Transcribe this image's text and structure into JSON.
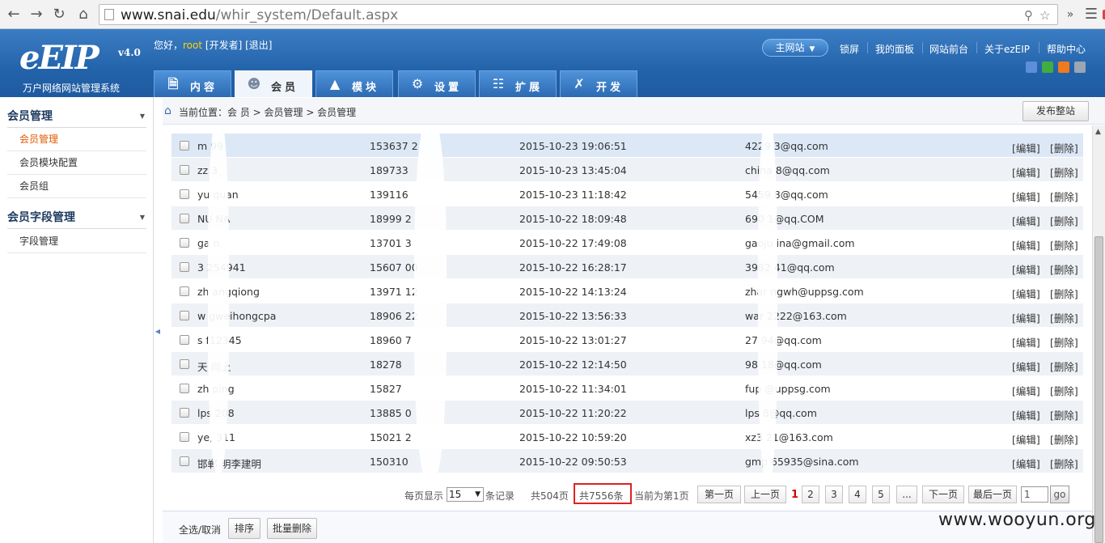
{
  "browser": {
    "url_host": "www.snai.edu",
    "url_path": "/whir_system/Default.aspx",
    "ext_badge": "6"
  },
  "header": {
    "logo": "eEIP",
    "logo_version": "v4.0",
    "logo_sub": "万户网络网站管理系统",
    "greeting": "您好，",
    "user": "root",
    "greeting_rest": "[开发者] [退出]",
    "site_select": "主网站",
    "links": [
      "锁屏",
      "我的面板",
      "网站前台",
      "关于ezEIP",
      "帮助中心"
    ],
    "skin_colors": [
      "#5b8fd6",
      "#3fae3f",
      "#f07a1e",
      "#9aa6b2"
    ],
    "tabs": [
      {
        "label": "内容",
        "icon": "document-icon"
      },
      {
        "label": "会员",
        "icon": "users-icon"
      },
      {
        "label": "模块",
        "icon": "cars-icon"
      },
      {
        "label": "设置",
        "icon": "gear-icon"
      },
      {
        "label": "扩展",
        "icon": "sitemap-icon"
      },
      {
        "label": "开发",
        "icon": "tools-icon"
      }
    ]
  },
  "sidebar": {
    "group1": "会员管理",
    "group1_items": [
      "会员管理",
      "会员模块配置",
      "会员组"
    ],
    "group2": "会员字段管理",
    "group2_items": [
      "字段管理"
    ]
  },
  "crumb": {
    "text": "当前位置：会 员 > 会员管理 > 会员管理",
    "publish": "发布整站"
  },
  "table": {
    "edit": "[编辑]",
    "delete": "[删除]",
    "rows": [
      {
        "name": "m    99",
        "phone": "153637    2",
        "time": "2015-10-23 19:06:51",
        "email": "4229      3@qq.com"
      },
      {
        "name": "zz    3",
        "phone": "189733",
        "time": "2015-10-23 13:45:04",
        "email": "china      8@qq.com"
      },
      {
        "name": "yu    quan",
        "phone": "139116",
        "time": "2015-10-23 11:18:42",
        "email": "5459      8@qq.com"
      },
      {
        "name": "NU    NA",
        "phone": "18999      2",
        "time": "2015-10-22 18:09:48",
        "email": "690      1@qq.COM"
      },
      {
        "name": "ga    n",
        "phone": "13701      3",
        "time": "2015-10-22 17:49:08",
        "email": "gaoju    ina@gmail.com"
      },
      {
        "name": "3    254941",
        "phone": "15607      00",
        "time": "2015-10-22 16:28:17",
        "email": "3982    41@qq.com"
      },
      {
        "name": "zh    angqiong",
        "phone": "13971      12",
        "time": "2015-10-22 14:13:24",
        "email": "zhar    ngwh@uppsg.com"
      },
      {
        "name": "w    gweihongcpa",
        "phone": "18906      22",
        "time": "2015-10-22 13:56:33",
        "email": "war    2222@163.com"
      },
      {
        "name": "s    f12345",
        "phone": "18960      7",
        "time": "2015-10-22 13:01:27",
        "email": "27      94@qq.com"
      },
      {
        "name": "天    向上",
        "phone": "18278",
        "time": "2015-10-22 12:14:50",
        "email": "98      18@qq.com"
      },
      {
        "name": "zh    ping",
        "phone": "15827",
        "time": "2015-10-22 11:34:01",
        "email": "fup      @uppsg.com"
      },
      {
        "name": "lps    208",
        "phone": "13885      0",
        "time": "2015-10-22 11:20:22",
        "email": "lps      8@qq.com"
      },
      {
        "name": "ye,    311",
        "phone": "15021      2",
        "time": "2015-10-22 10:59:20",
        "email": "xz3      21@163.com"
      },
      {
        "name": "邯郸    明李建明",
        "phone": "150310",
        "time": "2015-10-22 09:50:53",
        "email": "gmp      65935@sina.com"
      }
    ]
  },
  "pager": {
    "per_page_label": "每页显示",
    "per_page": "15",
    "records_label": "条记录",
    "pages": "共504页",
    "total": "共7556条",
    "current": "当前为第1页",
    "first": "第一页",
    "prev": "上一页",
    "page_nums": [
      "1",
      "2",
      "3",
      "4",
      "5",
      "..."
    ],
    "next": "下一页",
    "last": "最后一页",
    "goto_value": "1",
    "go": "go"
  },
  "bottom": {
    "select_all": "全选/取消",
    "sort": "排序",
    "batch_delete": "批量删除"
  },
  "watermark": "www.wooyun.org"
}
